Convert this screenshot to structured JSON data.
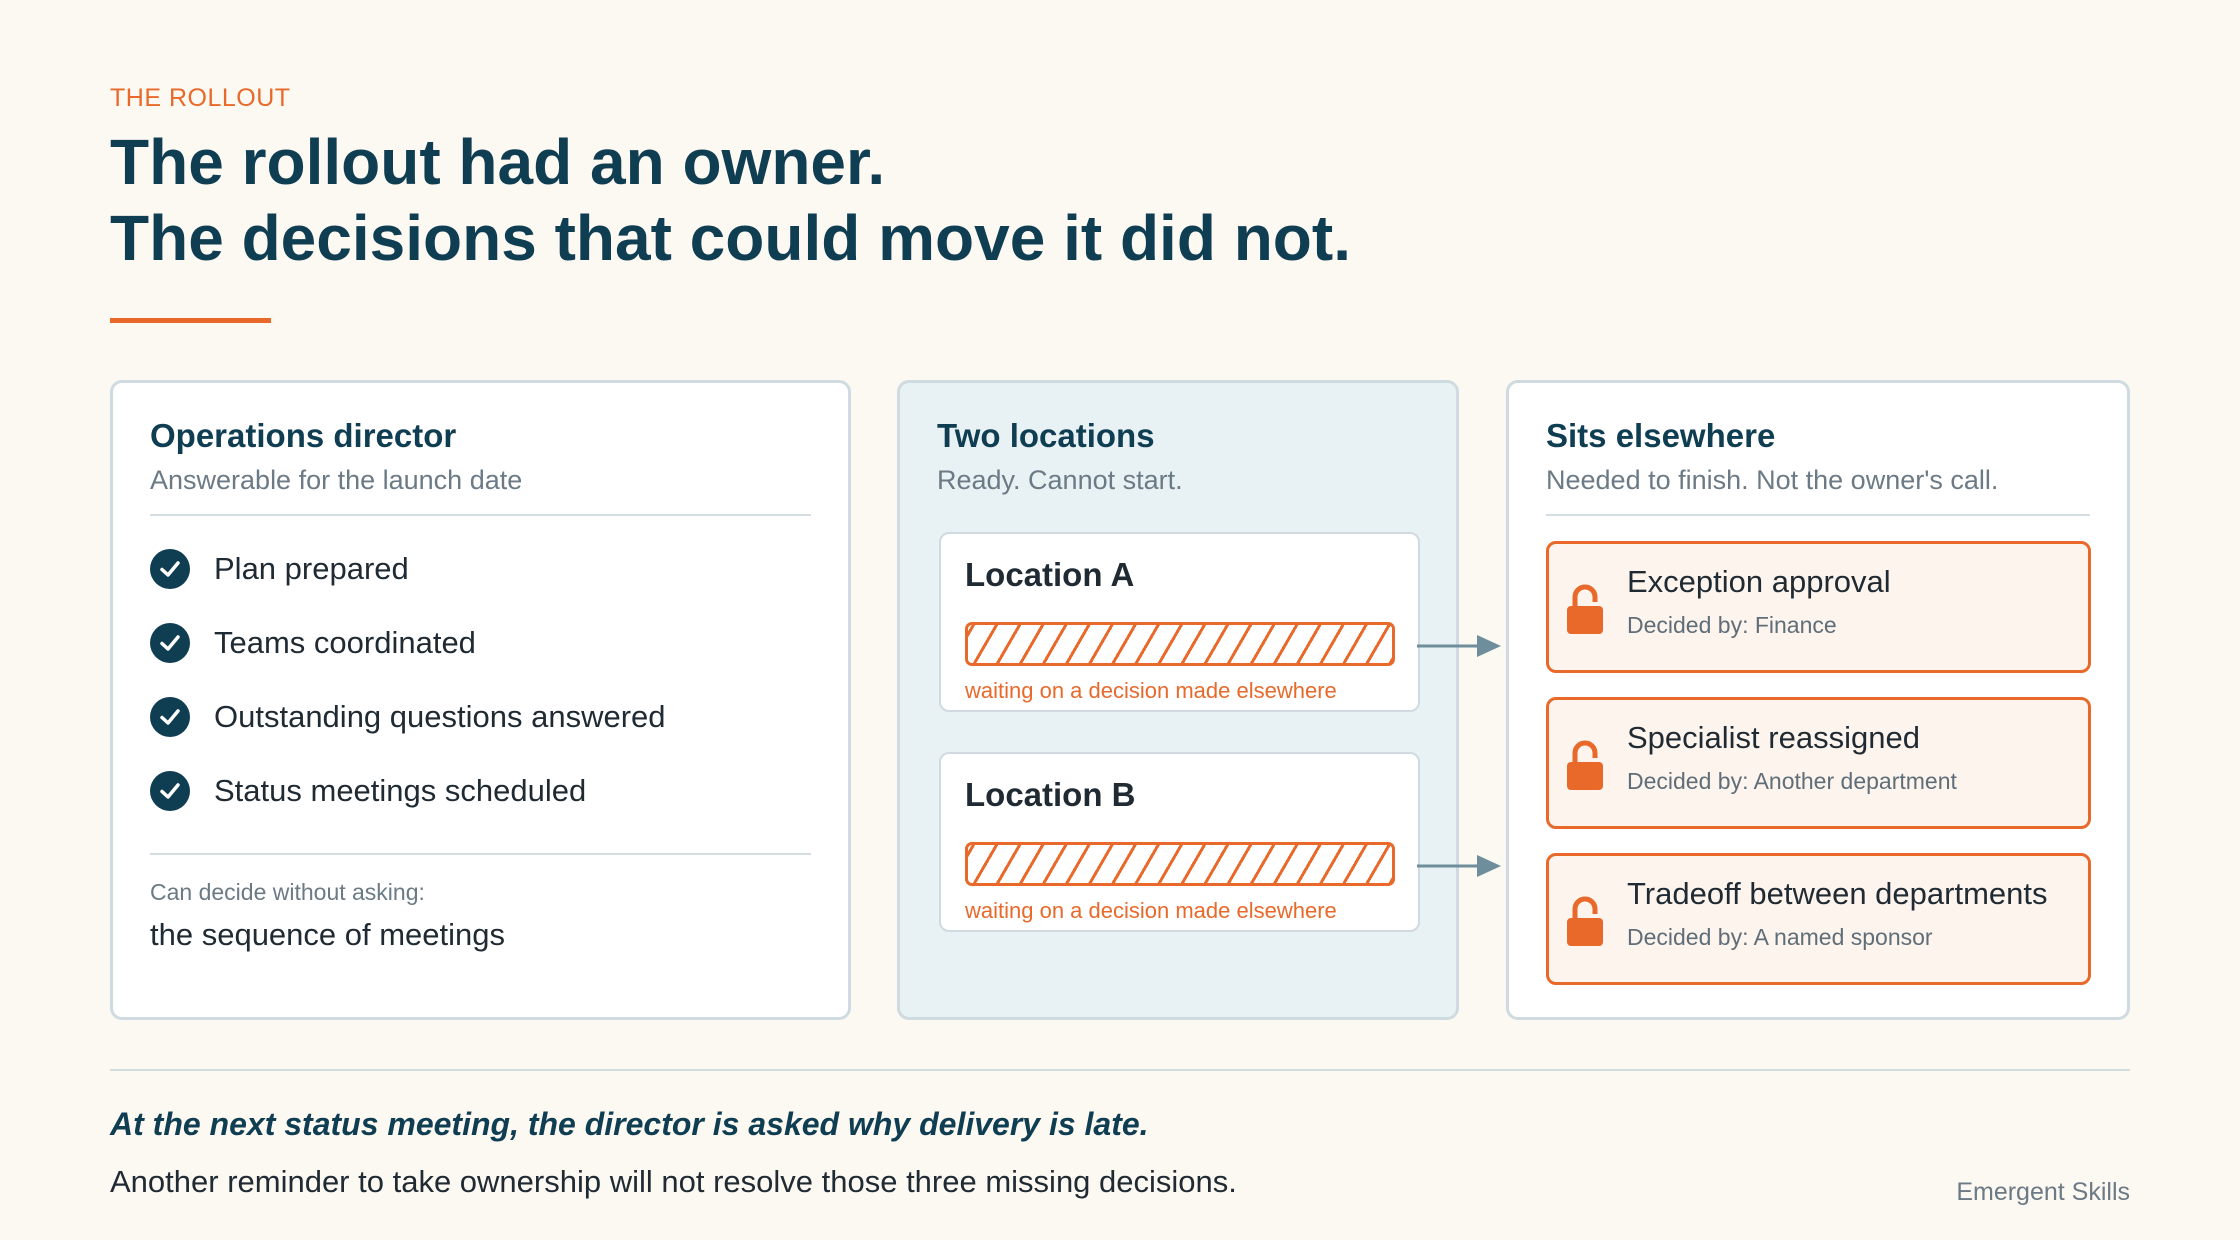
{
  "eyebrow": "THE ROLLOUT",
  "title": {
    "line1": "The rollout had an owner.",
    "line2": "The decisions that could move it did not."
  },
  "owner_panel": {
    "heading": "Operations director",
    "subheading": "Answerable for the launch date",
    "checks": [
      {
        "label": "Plan prepared",
        "icon": "check-circle-icon"
      },
      {
        "label": "Teams coordinated",
        "icon": "check-circle-icon"
      },
      {
        "label": "Outstanding questions answered",
        "icon": "check-circle-icon"
      },
      {
        "label": "Status meetings scheduled",
        "icon": "check-circle-icon"
      }
    ],
    "decide_label": "Can decide without asking:",
    "decide_value": "the sequence of meetings"
  },
  "locations_panel": {
    "heading": "Two locations",
    "subheading": "Ready. Cannot start.",
    "locations": [
      {
        "name": "Location A",
        "status": "waiting on a decision made elsewhere"
      },
      {
        "name": "Location B",
        "status": "waiting on a decision made elsewhere"
      }
    ]
  },
  "elsewhere_panel": {
    "heading": "Sits elsewhere",
    "subheading": "Needed to finish. Not the owner's call.",
    "decisions": [
      {
        "title": "Exception approval",
        "decided_by": "Decided by: Finance",
        "icon": "lock-icon"
      },
      {
        "title": "Specialist reassigned",
        "decided_by": "Decided by: Another department",
        "icon": "lock-icon"
      },
      {
        "title": "Tradeoff between departments",
        "decided_by": "Decided by: A named sponsor",
        "icon": "lock-icon"
      }
    ]
  },
  "footer": {
    "question": "At the next status meeting, the director is asked why delivery is late.",
    "statement": "Another reminder to take ownership will not resolve those three missing decisions.",
    "brand": "Emergent Skills"
  },
  "colors": {
    "accent": "#e8692a",
    "navy": "#0f3d52",
    "background": "#fcf8f2",
    "panel_tint": "#e8f1f4"
  }
}
